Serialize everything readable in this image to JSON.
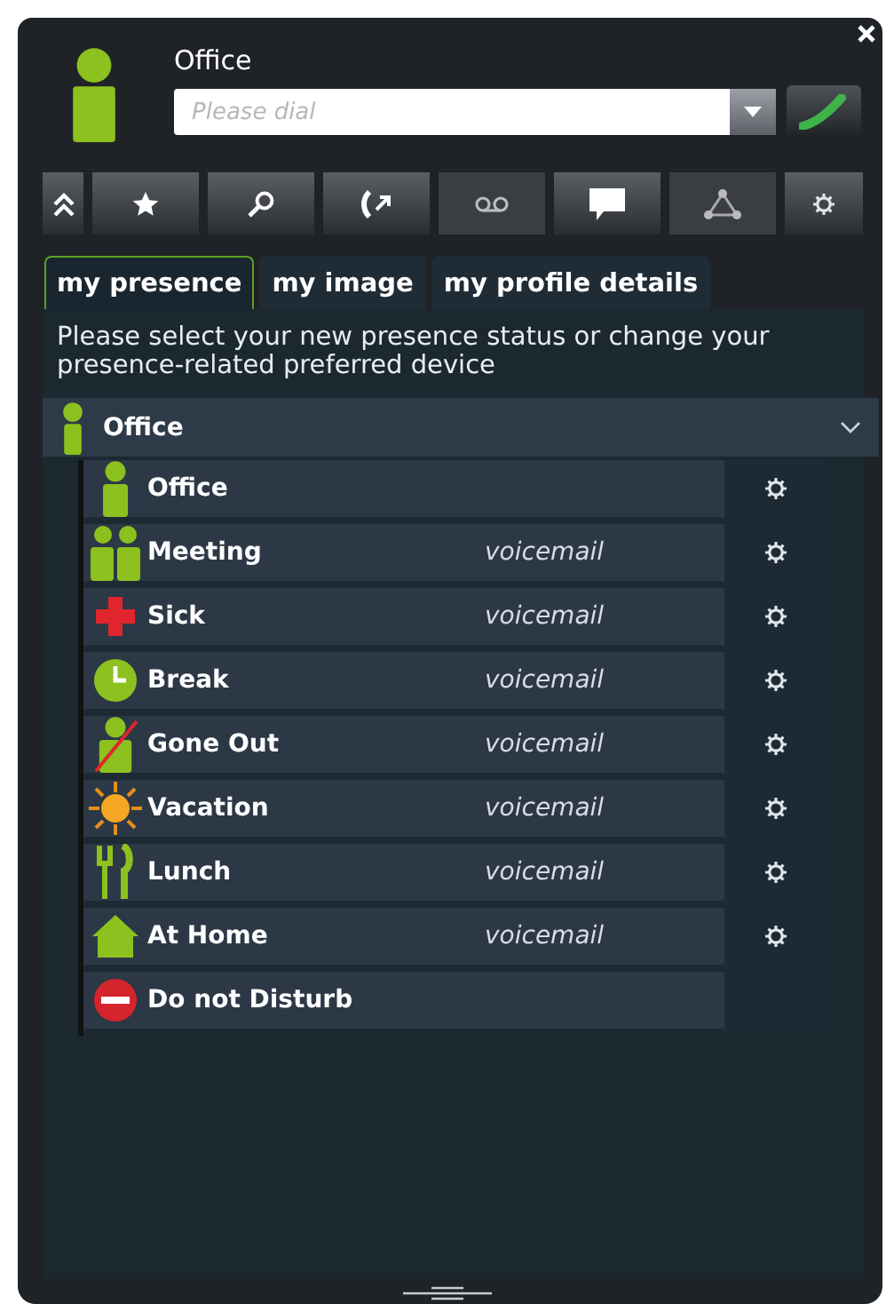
{
  "header": {
    "title": "Office",
    "dial_placeholder": "Please dial"
  },
  "toolbar": [
    {
      "kind": "collapse",
      "disabled": false
    },
    {
      "kind": "star",
      "disabled": false
    },
    {
      "kind": "search",
      "disabled": false
    },
    {
      "kind": "forward",
      "disabled": false
    },
    {
      "kind": "voicemail",
      "disabled": true
    },
    {
      "kind": "chat",
      "disabled": false
    },
    {
      "kind": "network",
      "disabled": true
    },
    {
      "kind": "settings",
      "disabled": false
    }
  ],
  "tabs": [
    {
      "label": "my presence",
      "selected": true
    },
    {
      "label": "my image",
      "selected": false
    },
    {
      "label": "my profile details",
      "selected": false
    }
  ],
  "description": "Please select your new presence status or change your presence-related preferred device",
  "current_status": {
    "label": "Office"
  },
  "statuses": [
    {
      "label": "Office",
      "settings": true
    },
    {
      "label": "Meeting",
      "device": "voicemail",
      "settings": true
    },
    {
      "label": "Sick",
      "device": "voicemail",
      "settings": true
    },
    {
      "label": "Break",
      "device": "voicemail",
      "settings": true
    },
    {
      "label": "Gone Out",
      "device": "voicemail",
      "settings": true
    },
    {
      "label": "Vacation",
      "device": "voicemail",
      "settings": true
    },
    {
      "label": "Lunch",
      "device": "voicemail",
      "settings": true
    },
    {
      "label": "At Home",
      "device": "voicemail",
      "settings": true
    },
    {
      "label": "Do not Disturb",
      "settings": false
    }
  ]
}
